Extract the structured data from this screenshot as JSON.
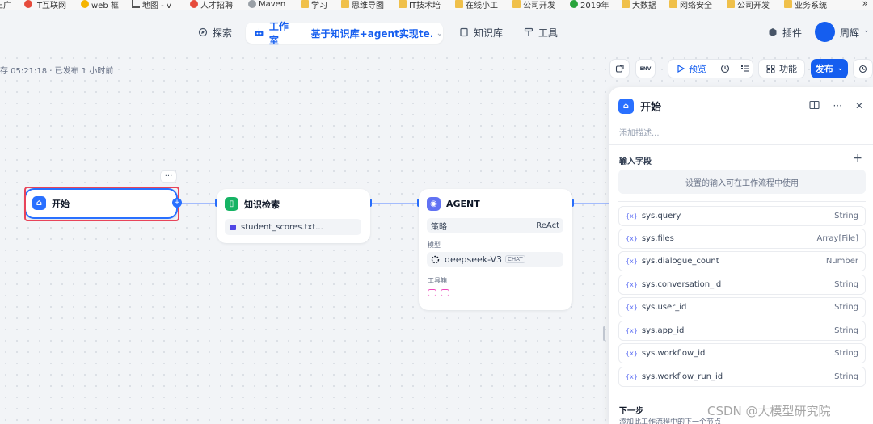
{
  "bookmarks": [
    {
      "label": "王广",
      "icon": "folder-icon"
    },
    {
      "label": "IT互联网",
      "icon": "red-bookmark-icon"
    },
    {
      "label": "web 框",
      "icon": "yellow-bookmark-icon"
    },
    {
      "label": "地图 - v",
      "icon": "chart-line-icon"
    },
    {
      "label": "人才招聘",
      "icon": "red-bookmark-icon"
    },
    {
      "label": "Maven",
      "icon": "globe-icon"
    },
    {
      "label": "学习",
      "icon": "folder-icon"
    },
    {
      "label": "思维导图",
      "icon": "folder-icon"
    },
    {
      "label": "IT技术培",
      "icon": "folder-icon"
    },
    {
      "label": "在线小工",
      "icon": "folder-icon"
    },
    {
      "label": "公司开发",
      "icon": "folder-icon"
    },
    {
      "label": "2019年",
      "icon": "green-bookmark-icon"
    },
    {
      "label": "大数据",
      "icon": "folder-icon"
    },
    {
      "label": "网络安全",
      "icon": "folder-icon"
    },
    {
      "label": "公司开发",
      "icon": "folder-icon"
    },
    {
      "label": "业务系统",
      "icon": "folder-icon"
    }
  ],
  "bookmarks_more": "»",
  "nav": {
    "explore": "探索",
    "studio": "工作室",
    "app_name": "基于知识库+agent实现te...",
    "knowledge": "知识库",
    "tools": "工具",
    "plugins": "插件",
    "user_name": "周辉"
  },
  "autosave": "存 05:21:18 · 已发布 1 小时前",
  "toolbar": {
    "env_label": "ENV",
    "preview": "预览",
    "features": "功能",
    "publish": "发布"
  },
  "nodes": {
    "start": {
      "title": "开始"
    },
    "knowledge": {
      "title": "知识检索",
      "file": "student_scores.txt..."
    },
    "agent": {
      "title": "AGENT",
      "strategy_label": "策略",
      "strategy_value": "ReAct",
      "model_label": "模型",
      "model_name": "deepseek-V3",
      "model_badge": "CHAT",
      "toolbox_label": "工具箱"
    }
  },
  "panel": {
    "title": "开始",
    "description_placeholder": "添加描述...",
    "input_fields_label": "输入字段",
    "input_hint": "设置的输入可在工作流程中使用",
    "fields": [
      {
        "name": "sys.query",
        "type": "String"
      },
      {
        "name": "sys.files",
        "type": "Array[File]"
      },
      {
        "name": "sys.dialogue_count",
        "type": "Number"
      },
      {
        "name": "sys.conversation_id",
        "type": "String"
      },
      {
        "name": "sys.user_id",
        "type": "String"
      },
      {
        "name": "sys.app_id",
        "type": "String"
      },
      {
        "name": "sys.workflow_id",
        "type": "String"
      },
      {
        "name": "sys.workflow_run_id",
        "type": "String"
      }
    ],
    "var_prefix": "{x}",
    "next_step_label": "下一步",
    "next_step_desc": "添加此工作流程中的下一个节点"
  },
  "watermark": "CSDN @大模型研究院",
  "colors": {
    "accent": "#155eef",
    "start_highlight": "#e8445a",
    "agent_icon": "#6172f3",
    "knowledge_icon": "#16b364"
  }
}
